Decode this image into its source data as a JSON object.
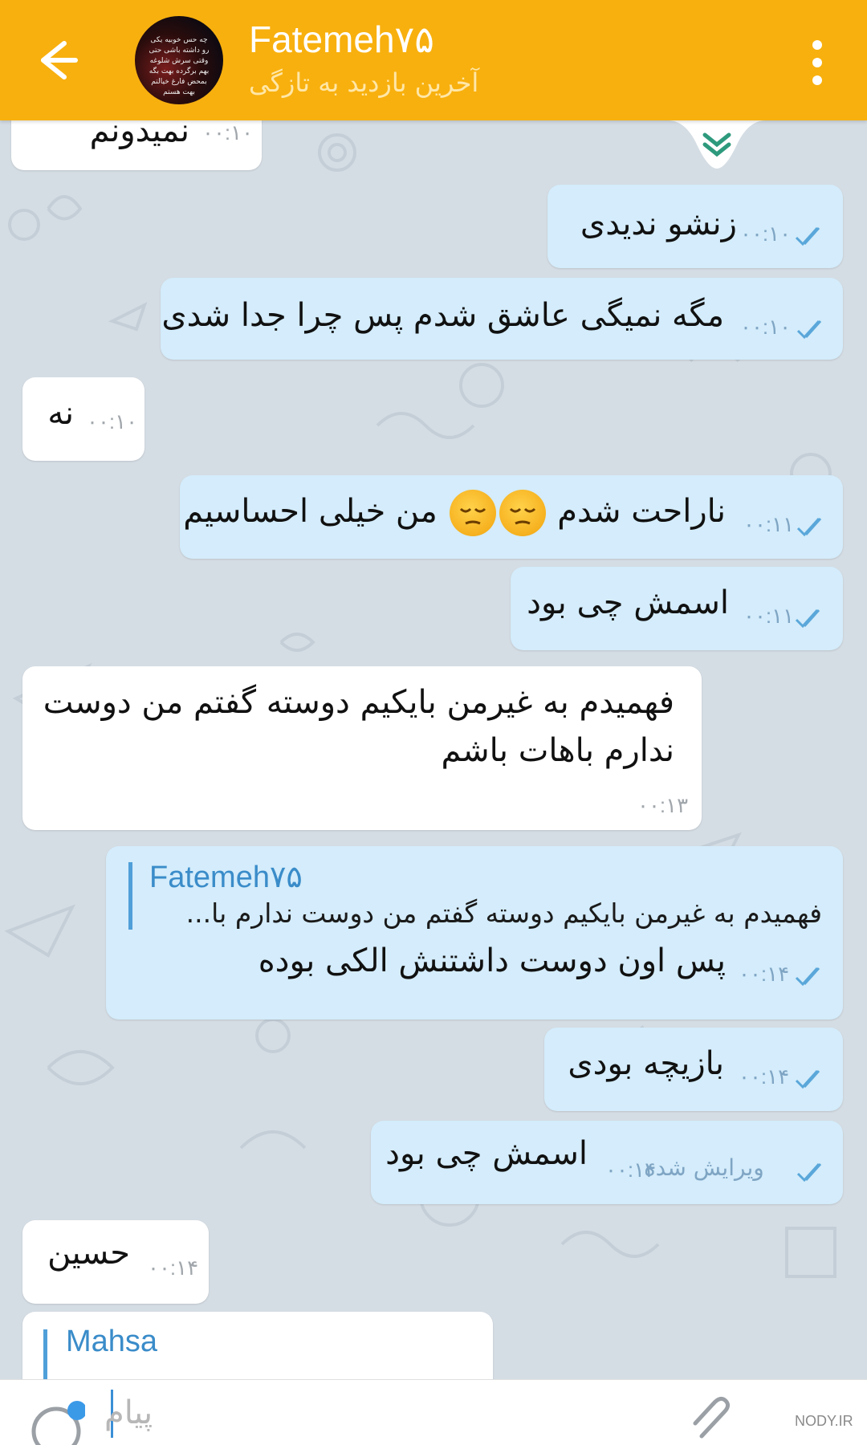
{
  "header": {
    "contact_name": "Fatemeh۷۵",
    "status": "آخرین بازدید به تازگی",
    "avatar_text": "چه حس خوبیه یکی رو داشته باشی حتی وقتی سرش شلوغه بهم برگرده بهت بگه بمحض فارغ خیالتم بهت هستم",
    "colors": {
      "bar": "#f8b00e",
      "outgoing_bubble": "#d4ecfb",
      "incoming_bubble": "#ffffff",
      "time": "#7fa5c4"
    }
  },
  "messages": [
    {
      "direction": "in",
      "text": "نمیدونم",
      "time": "۰۰:۱۰"
    },
    {
      "direction": "out",
      "text": "زنشو ندیدی",
      "time": "۰۰:۱۰",
      "read": true
    },
    {
      "direction": "out",
      "text": "مگه نمیگی عاشق شدم پس چرا جدا شدی",
      "time": "۰۰:۱۰",
      "read": true
    },
    {
      "direction": "in",
      "text": "نه",
      "time": "۰۰:۱۰"
    },
    {
      "direction": "out",
      "text_before": "ناراحت شدم",
      "text_after": "من خیلی احساسیم",
      "emoji": "pensive-face x2",
      "time": "۰۰:۱۱",
      "read": true
    },
    {
      "direction": "out",
      "text": "اسمش چی بود",
      "time": "۰۰:۱۱",
      "read": true
    },
    {
      "direction": "in",
      "line1": "فهمیدم به غیرمن بایکیم دوسته گفتم من  دوست",
      "line2": "ندارم  باهات باشم",
      "time": "۰۰:۱۳"
    },
    {
      "direction": "out",
      "reply_to_name": "Fatemeh۷۵",
      "reply_to_text": "فهمیدم به غیرمن بایکیم دوسته گفتم من  دوست ندارم  با...",
      "text": "پس اون دوست داشتنش الکی بوده",
      "time": "۰۰:۱۴",
      "read": true
    },
    {
      "direction": "out",
      "text": "بازیچه بودی",
      "time": "۰۰:۱۴",
      "read": true
    },
    {
      "direction": "out",
      "text": "اسمش چی بود",
      "edited_label": "ویرایش شده",
      "time": "۰۰:۱۴",
      "read": true
    },
    {
      "direction": "in",
      "text": "حسین",
      "time": "۰۰:۱۴"
    },
    {
      "direction": "in",
      "reply_to_name": "Mahsa"
    }
  ],
  "input": {
    "placeholder": "پیام"
  },
  "watermark": "NODY.IR"
}
